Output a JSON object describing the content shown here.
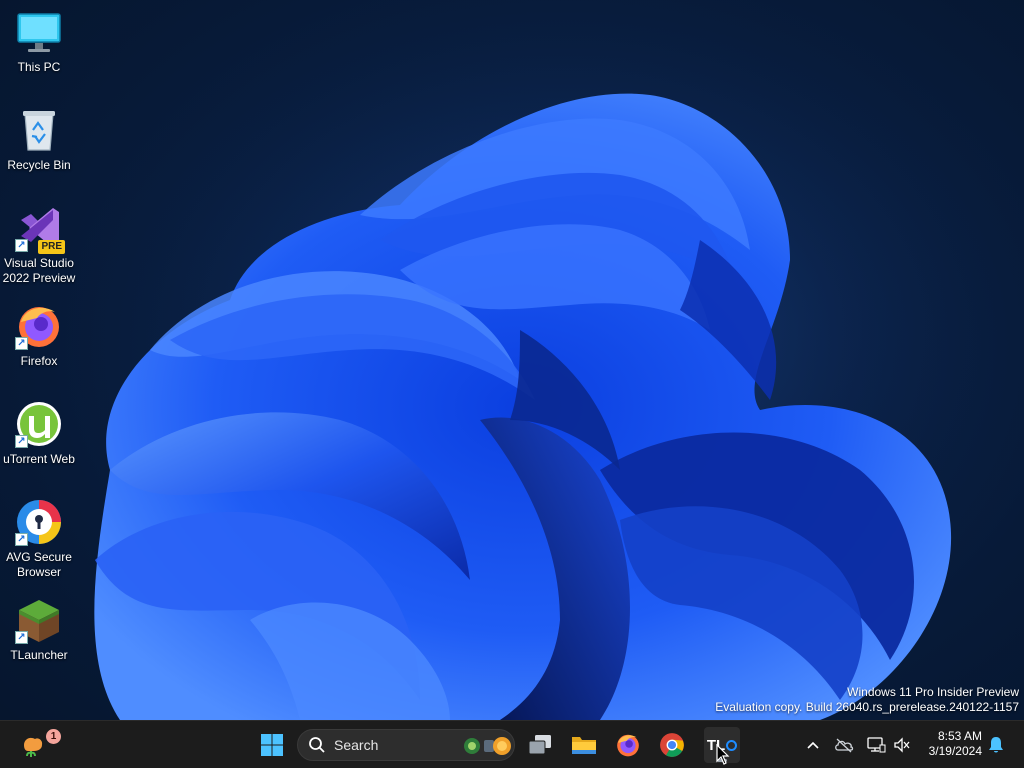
{
  "desktop": {
    "icons": [
      {
        "name": "this-pc",
        "label": "This PC",
        "icon": "monitor-icon"
      },
      {
        "name": "recycle-bin",
        "label": "Recycle Bin",
        "icon": "recycle-bin-icon"
      },
      {
        "name": "visual-studio",
        "label": "Visual Studio 2022 Preview",
        "icon": "visual-studio-icon",
        "badge": "PRE"
      },
      {
        "name": "firefox",
        "label": "Firefox",
        "icon": "firefox-icon"
      },
      {
        "name": "utorrent-web",
        "label": "uTorrent Web",
        "icon": "utorrent-icon"
      },
      {
        "name": "avg-secure-browser",
        "label": "AVG Secure Browser",
        "icon": "avg-browser-icon"
      },
      {
        "name": "tlauncher",
        "label": "TLauncher",
        "icon": "minecraft-grass-block-icon"
      }
    ]
  },
  "watermark": {
    "line1": "Windows 11 Pro Insider Preview",
    "line2": "Evaluation copy. Build 26040.rs_prerelease.240122-1157"
  },
  "taskbar": {
    "widgets": {
      "icon": "weather-widget-icon",
      "badge_count": "1"
    },
    "search": {
      "placeholder": "Search",
      "icon": "search-icon"
    },
    "apps": [
      {
        "name": "start",
        "icon": "windows-logo-icon"
      },
      {
        "name": "task-view",
        "icon": "task-view-icon"
      },
      {
        "name": "file-explorer",
        "icon": "folder-icon"
      },
      {
        "name": "firefox",
        "icon": "firefox-icon"
      },
      {
        "name": "chrome",
        "icon": "chrome-icon"
      },
      {
        "name": "tlauncher",
        "icon": "tlauncher-icon",
        "label": "TL",
        "active": true
      }
    ],
    "tray": {
      "icons": [
        "chevron-up-icon",
        "onedrive-offline-icon",
        "network-icon",
        "volume-muted-icon",
        "bell-icon"
      ],
      "time": "8:53 AM",
      "date": "3/19/2024"
    }
  },
  "colors": {
    "taskbar_bg": "#1c1c1c",
    "wallpaper_bg": "#0a2147",
    "bloom_blue": "#1f5cf5",
    "accent_blue": "#4cc2ff"
  }
}
